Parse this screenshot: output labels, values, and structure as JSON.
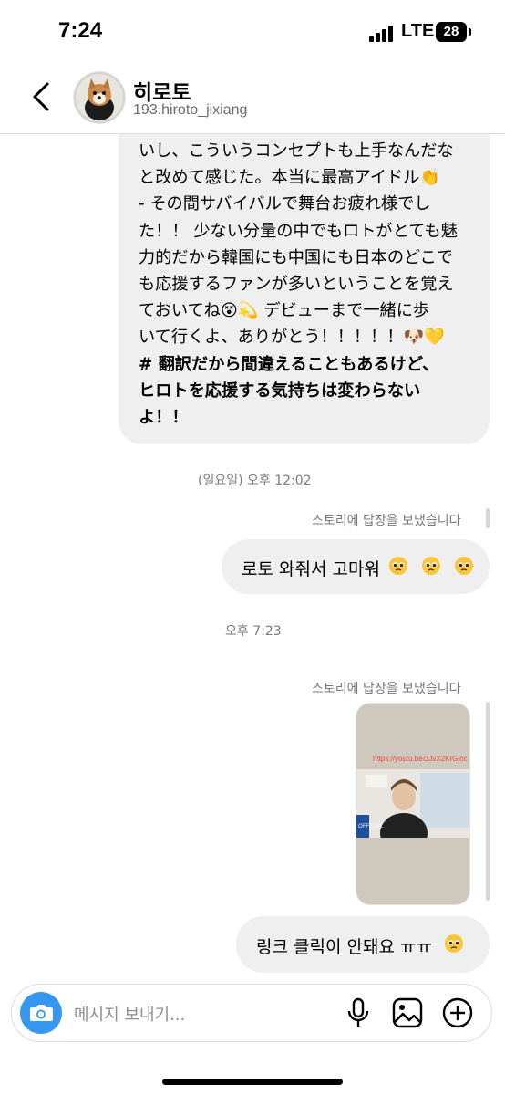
{
  "status_bar": {
    "time": "7:24",
    "network": "LTE",
    "battery": "28"
  },
  "header": {
    "name": "히로토",
    "handle": "193.hiroto_jixiang"
  },
  "messages": {
    "incoming_lines": [
      "いし、こういうコンセプトも上手なんだな",
      "と改めて感じた。本当に最高アイドル👏",
      "- その間サバイバルで舞台お疲れ様でし",
      "た！！ 少ない分量の中でもロトがとても魅",
      "力的だから韓国にも中国にも日本のどこで",
      "も応援するファンが多いということを覚え",
      "ておいてね😵💫 デビューまで一緒に歩",
      "いて行くよ、ありがとう！！！！！🐶💛"
    ],
    "incoming_bold_lines": [
      "# 翻訳だから間違えることもあるけど、",
      "ヒロトを応援する気持ちは変わらない",
      "よ！！"
    ],
    "timestamp_1": "(일요일) 오후 12:02",
    "caption_1": "스토리에 답장을 보냈습니다",
    "reply_1": "로토 와줘서 고마워",
    "timestamp_2": "오후 7:23",
    "caption_2": "스토리에 답장을 보냈습니다",
    "story_link": "https://youtu.be/3JvX2KrGjnc",
    "story_logo": "OFFICIAL",
    "reply_2": "링크 클릭이 안돼요 ㅠㅠ"
  },
  "composer": {
    "placeholder": "메시지 보내기..."
  },
  "icons": [
    "back-icon",
    "camera-icon",
    "microphone-icon",
    "gallery-icon",
    "plus-icon"
  ],
  "colors": {
    "bubble": "#efefef",
    "accent": "#3797f0",
    "story_link": "#e24b43"
  }
}
